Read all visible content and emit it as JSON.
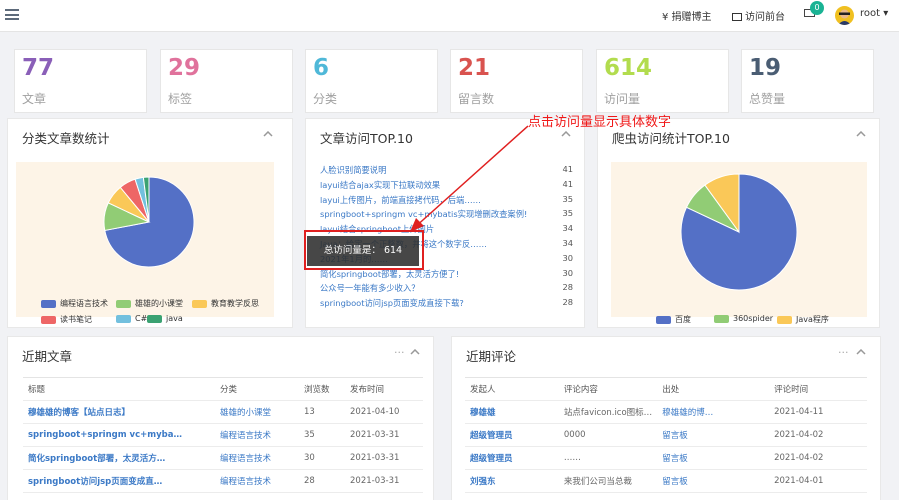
{
  "nav": {
    "donate": "¥ 捐赠博主",
    "front": "访问前台",
    "mail_count": "0",
    "user": "root"
  },
  "stats": [
    {
      "num": "77",
      "label": "文章",
      "color": "#8a5fb8",
      "icon": "leaf-icon"
    },
    {
      "num": "29",
      "label": "标签",
      "color": "#e0729c",
      "icon": "tag-icon"
    },
    {
      "num": "6",
      "label": "分类",
      "color": "#4fb8d8",
      "icon": "grid-icon"
    },
    {
      "num": "21",
      "label": "留言数",
      "color": "#d9534f",
      "icon": "comments-icon"
    },
    {
      "num": "614",
      "label": "访问量",
      "color": "#b2dc4e",
      "icon": "bar-chart-icon"
    },
    {
      "num": "19",
      "label": "总赞量",
      "color": "#4a5d73",
      "icon": "thumbs-up-icon"
    }
  ],
  "panels": {
    "cat": "分类文章数统计",
    "top": "文章访问TOP.10",
    "spider": "爬虫访问统计TOP.10",
    "recent": "近期文章",
    "comments": "近期评论",
    "dots": "···"
  },
  "cat_legend": [
    "编程语言技术",
    "雄雄的小课堂",
    "教育教学反思",
    "读书笔记",
    "C#",
    "java"
  ],
  "spider_legend": [
    "百度",
    "360spider",
    "Java程序"
  ],
  "chart_data": [
    {
      "type": "pie",
      "values": [
        72,
        10,
        7,
        6,
        3,
        2
      ],
      "colors": [
        "#5470c6",
        "#91cc75",
        "#fac858",
        "#ee6666",
        "#73c0de",
        "#3ba272"
      ],
      "legend": [
        "编程语言技术",
        "雄雄的小课堂",
        "教育教学反思",
        "读书笔记",
        "C#",
        "java"
      ]
    },
    {
      "type": "pie",
      "values": [
        82,
        8,
        10
      ],
      "colors": [
        "#5470c6",
        "#91cc75",
        "#fac858"
      ],
      "legend": [
        "百度",
        "360spider",
        "Java程序"
      ]
    }
  ],
  "top10": [
    {
      "t": "人脸识别简要说明",
      "n": "41"
    },
    {
      "t": "layui结合ajax实现下拉联动效果",
      "n": "41"
    },
    {
      "t": "layui上传图片，前端直接拷代码，后端……",
      "n": "35"
    },
    {
      "t": "springboot+springm vc+mybatis实现增删改查案例!",
      "n": "35"
    },
    {
      "t": "layui结合springboot上传图片",
      "n": "34"
    },
    {
      "t": "Java：给定一个正整数，并将这个数字反……",
      "n": "34"
    },
    {
      "t": "2021年1月的……",
      "n": "30"
    },
    {
      "t": "简化springboot部署，太灵活方便了!",
      "n": "30"
    },
    {
      "t": "公众号一年能有多少收入？",
      "n": "28"
    },
    {
      "t": "springboot访问jsp页面变成直接下载?",
      "n": "28"
    }
  ],
  "tooltip": "总访问量是： 614",
  "annotation": "点击访问量显示具体数字",
  "recent_head": [
    "标题",
    "分类",
    "浏览数",
    "发布时间"
  ],
  "recent_rows": [
    [
      "穆雄雄的博客【站点日志】",
      "雄雄的小课堂",
      "13",
      "2021-04-10"
    ],
    [
      "springboot+springm vc+myba…",
      "编程语言技术",
      "35",
      "2021-03-31"
    ],
    [
      "简化springboot部署，太灵活方…",
      "编程语言技术",
      "30",
      "2021-03-31"
    ],
    [
      "springboot访问jsp页面变成直…",
      "编程语言技术",
      "28",
      "2021-03-31"
    ]
  ],
  "comment_head": [
    "发起人",
    "评论内容",
    "出处",
    "评论时间"
  ],
  "comment_rows": [
    [
      "穆雄雄",
      "站点favicon.ico图标…",
      "穆雄雄的博…",
      "2021-04-11"
    ],
    [
      "超级管理员",
      "0000",
      "留言板",
      "2021-04-02"
    ],
    [
      "超级管理员",
      "……",
      "留言板",
      "2021-04-02"
    ],
    [
      "刘强东",
      "来我们公司当总裁",
      "留言板",
      "2021-04-01"
    ]
  ]
}
